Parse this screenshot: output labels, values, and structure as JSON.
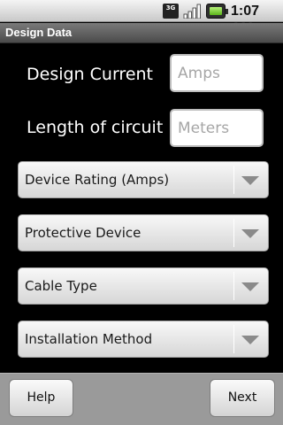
{
  "status_bar": {
    "network_badge": "3G",
    "icons": [
      "network-3g-icon",
      "signal-icon",
      "battery-icon"
    ],
    "time": "1:07 AM"
  },
  "title_bar": {
    "title": "Design Data"
  },
  "form": {
    "design_current": {
      "label": "Design Current",
      "placeholder": "Amps",
      "value": ""
    },
    "length_of_circuit": {
      "label": "Length of circuit",
      "placeholder": "Meters",
      "value": ""
    }
  },
  "spinners": [
    {
      "label": "Device Rating (Amps)"
    },
    {
      "label": "Protective Device"
    },
    {
      "label": "Cable Type"
    },
    {
      "label": "Installation Method"
    }
  ],
  "buttons": {
    "help": "Help",
    "next": "Next"
  },
  "colors": {
    "background": "#000000",
    "title_bar": "#5e5e5e",
    "bottom_bar": "#9a9a9a",
    "battery_fill": "#6fc326"
  }
}
